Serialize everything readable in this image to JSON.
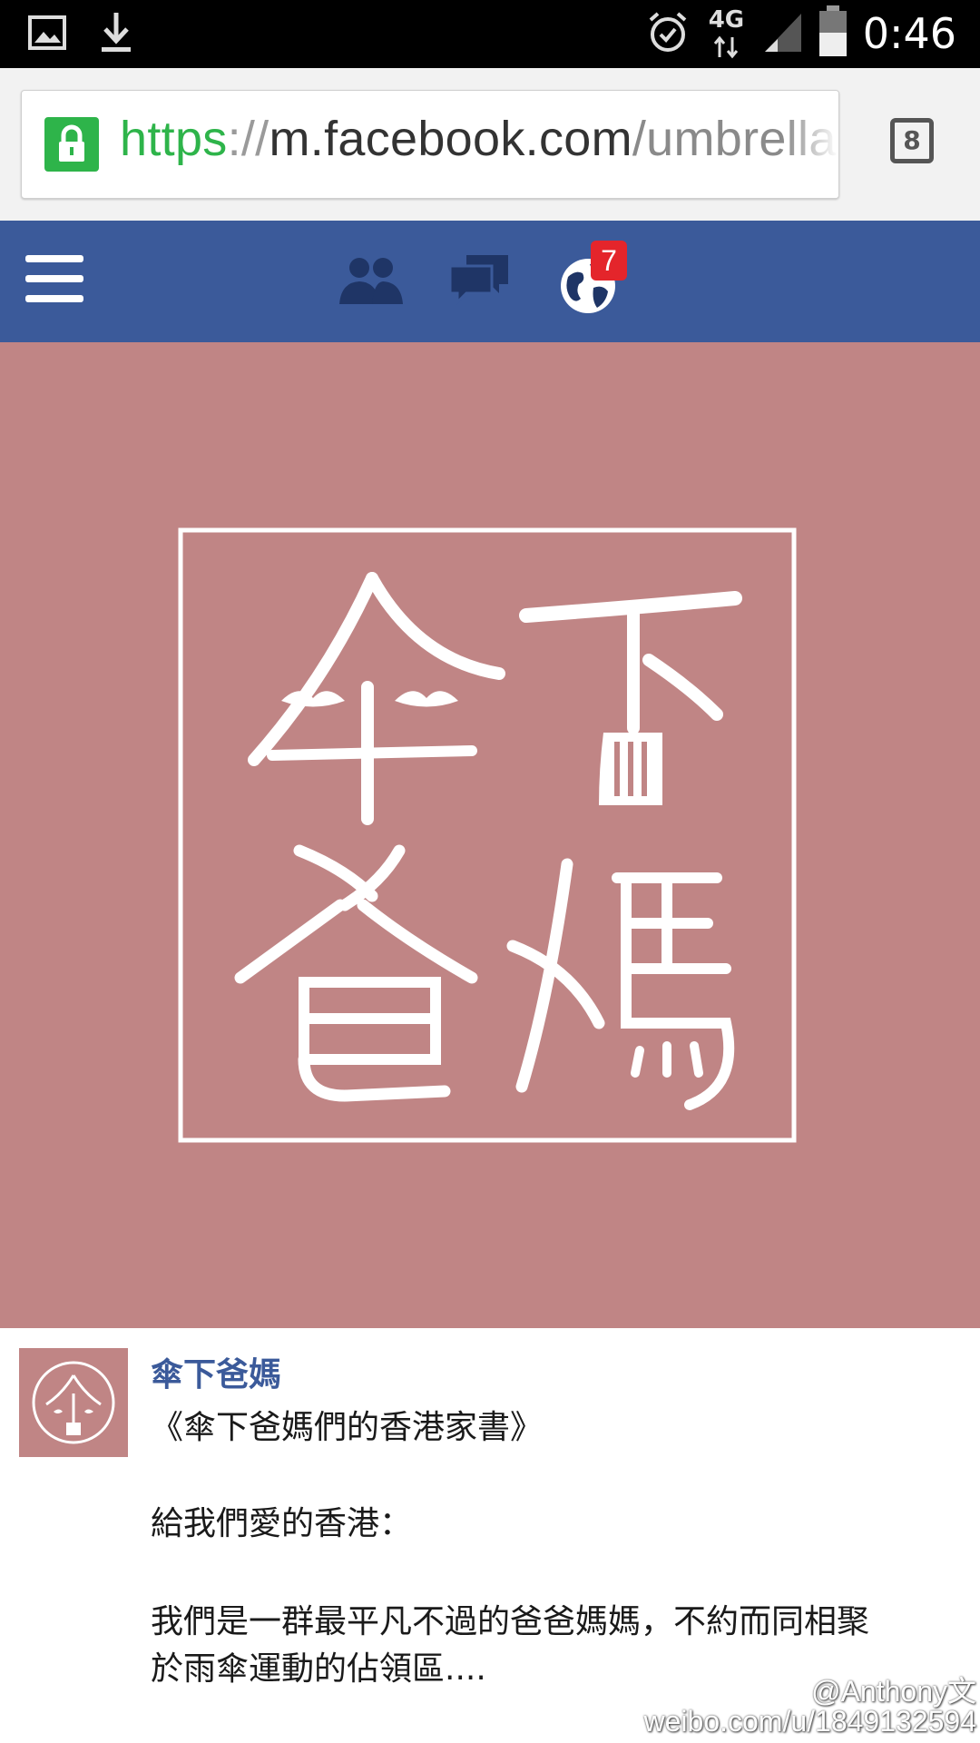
{
  "status_bar": {
    "time": "0:46",
    "network": "4G",
    "icons": [
      "image-icon",
      "download-icon",
      "alarm-icon",
      "network-4g-icon",
      "signal-icon",
      "battery-icon"
    ]
  },
  "browser": {
    "url_scheme": "https",
    "url_separator": "://",
    "url_host": "m.facebook.com",
    "url_path": "/umbrella",
    "tab_count": "8"
  },
  "fb_nav": {
    "icons": [
      "menu-icon",
      "friend-requests-icon",
      "messages-icon",
      "notifications-globe-icon"
    ],
    "notifications_badge": "7",
    "colors": {
      "bar": "#3b5a9a",
      "icon": "#1f3566",
      "badge": "#e4252b"
    }
  },
  "cover": {
    "logo_text": "傘下爸媽",
    "background": "#c08585"
  },
  "post": {
    "page_name": "傘下爸媽",
    "title": "《傘下爸媽們的香港家書》",
    "salutation": "給我們愛的香港：",
    "body_line1": "我們是一群最平凡不過的爸爸媽媽，不約而同相聚",
    "body_line2": "於雨傘運動的佔領區...."
  },
  "watermark": {
    "handle": "@Anthony文",
    "url": "weibo.com/u/1849132594"
  }
}
